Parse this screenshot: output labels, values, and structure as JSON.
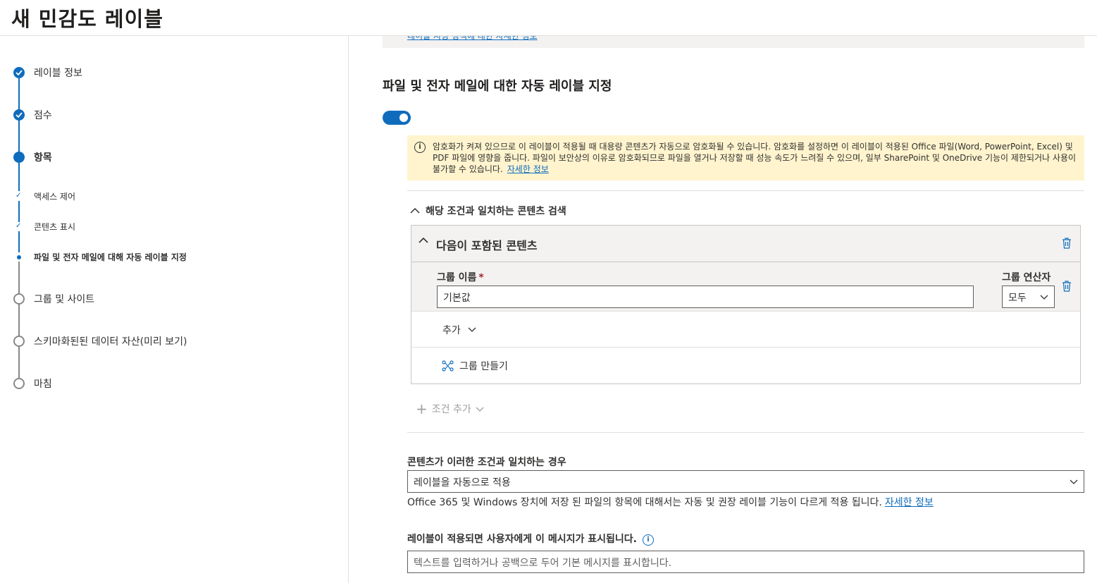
{
  "header": {
    "title": "새 민감도 레이블"
  },
  "steps": [
    {
      "label": "레이블 정보",
      "state": "done"
    },
    {
      "label": "점수",
      "state": "done"
    },
    {
      "label": "항목",
      "state": "current"
    },
    {
      "label": "액세스 제어",
      "state": "sub-done"
    },
    {
      "label": "콘텐츠 표시",
      "state": "sub-done"
    },
    {
      "label": "파일 및 전자 메일에 대해 자동 레이블 지정",
      "state": "sub-current"
    },
    {
      "label": "그룹 및 사이트",
      "state": "todo"
    },
    {
      "label": "스키마화된된 데이터 자산(미리 보기)",
      "state": "todo"
    },
    {
      "label": "마침",
      "state": "todo"
    }
  ],
  "main": {
    "top_link": "레이블 지정 정책에 대한 자세한 정보",
    "section_title": "파일 및 전자 메일에 대한 자동 레이블 지정",
    "toggle_on": true,
    "warning": {
      "text": "암호화가 켜져 있으므로 이 레이블이 적용될 때 대용량 콘텐츠가 자동으로 암호화될 수 있습니다. 암호화를 설정하면 이 레이블이 적용된 Office 파일(Word, PowerPoint, Excel) 및 PDF 파일에 영향을 줍니다. 파일이 보안상의 이유로 암호화되므로 파일을 열거나 저장할 때 성능 속도가 느려질 수 있으며, 일부 SharePoint 및 OneDrive 기능이 제한되거나 사용이 불가할 수 있습니다.",
      "link": "자세한 정보"
    },
    "search_header": "해당 조건과 일치하는 콘텐츠 검색",
    "group": {
      "title": "다음이 포함된 콘텐츠",
      "name_label": "그룹 이름",
      "required_mark": "*",
      "name_value": "기본값",
      "operator_label": "그룹 연산자",
      "operator_value": "모두",
      "add_label": "추가",
      "create_group_label": "그룹 만들기"
    },
    "add_condition": "조건 추가",
    "match": {
      "label": "콘텐츠가 이러한 조건과 일치하는 경우",
      "value": "레이블을 자동으로 적용",
      "note": "Office 365 및 Windows 장치에 저장 된 파일의 항목에 대해서는 자동 및 권장 레이블 기능이 다르게 적용 됩니다.",
      "note_link": "자세한 정보"
    },
    "message": {
      "label": "레이블이 적용되면 사용자에게 이 메시지가 표시됩니다.",
      "placeholder": "텍스트를 입력하거나 공백으로 두어 기본 메시지를 표시합니다."
    }
  },
  "colors": {
    "accent": "#0f6cbd",
    "warning_bg": "#fff4ce",
    "gray_bg": "#f3f2f1"
  }
}
